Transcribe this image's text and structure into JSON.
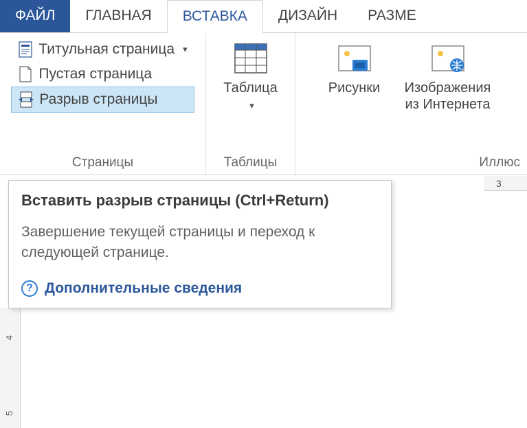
{
  "tabs": {
    "file": "ФАЙЛ",
    "home": "ГЛАВНАЯ",
    "insert": "ВСТАВКА",
    "design": "ДИЗАЙН",
    "layout": "РАЗМЕ"
  },
  "groups": {
    "pages": {
      "label": "Страницы",
      "cover_page": "Титульная страница",
      "blank_page": "Пустая страница",
      "page_break": "Разрыв страницы"
    },
    "tables": {
      "label": "Таблицы",
      "table": "Таблица"
    },
    "illustrations": {
      "label": "Иллюс",
      "pictures": "Рисунки",
      "online_pictures_l1": "Изображения",
      "online_pictures_l2": "из Интернета"
    }
  },
  "tooltip": {
    "title": "Вставить разрыв страницы (Ctrl+Return)",
    "desc": "Завершение текущей страницы и переход к следующей странице.",
    "more": "Дополнительные сведения"
  },
  "ruler": {
    "h_tick": "3",
    "v_tick1": "4",
    "v_tick2": "5"
  }
}
